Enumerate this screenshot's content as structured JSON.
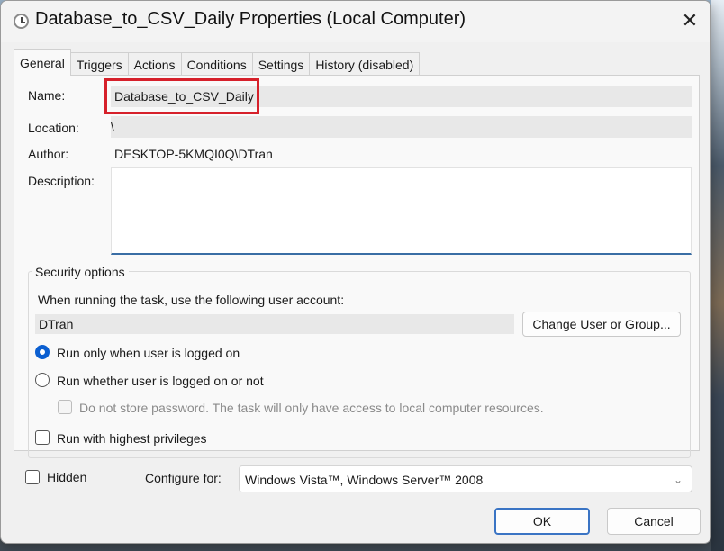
{
  "window": {
    "title": "Database_to_CSV_Daily Properties (Local Computer)",
    "close_glyph": "✕"
  },
  "tabs": [
    {
      "label": "General",
      "active": true
    },
    {
      "label": "Triggers",
      "active": false
    },
    {
      "label": "Actions",
      "active": false
    },
    {
      "label": "Conditions",
      "active": false
    },
    {
      "label": "Settings",
      "active": false
    },
    {
      "label": "History (disabled)",
      "active": false
    }
  ],
  "general": {
    "name_label": "Name:",
    "name_value": "Database_to_CSV_Daily",
    "location_label": "Location:",
    "location_value": "\\",
    "author_label": "Author:",
    "author_value": "DESKTOP-5KMQI0Q\\DTran",
    "description_label": "Description:",
    "description_value": ""
  },
  "security": {
    "title": "Security options",
    "account_prompt": "When running the task, use the following user account:",
    "account_value": "DTran",
    "change_user_button": "Change User or Group...",
    "radio_logged_on": "Run only when user is logged on",
    "radio_whether": "Run whether user is logged on or not",
    "do_not_store": "Do not store password.  The task will only have access to local computer resources.",
    "highest_privileges": "Run with highest privileges"
  },
  "footer": {
    "hidden_label": "Hidden",
    "configure_label": "Configure for:",
    "configure_value": "Windows Vista™, Windows Server™ 2008",
    "ok_button": "OK",
    "cancel_button": "Cancel"
  },
  "colors": {
    "accent": "#0b5fd1",
    "highlight_box": "#d6202a"
  }
}
